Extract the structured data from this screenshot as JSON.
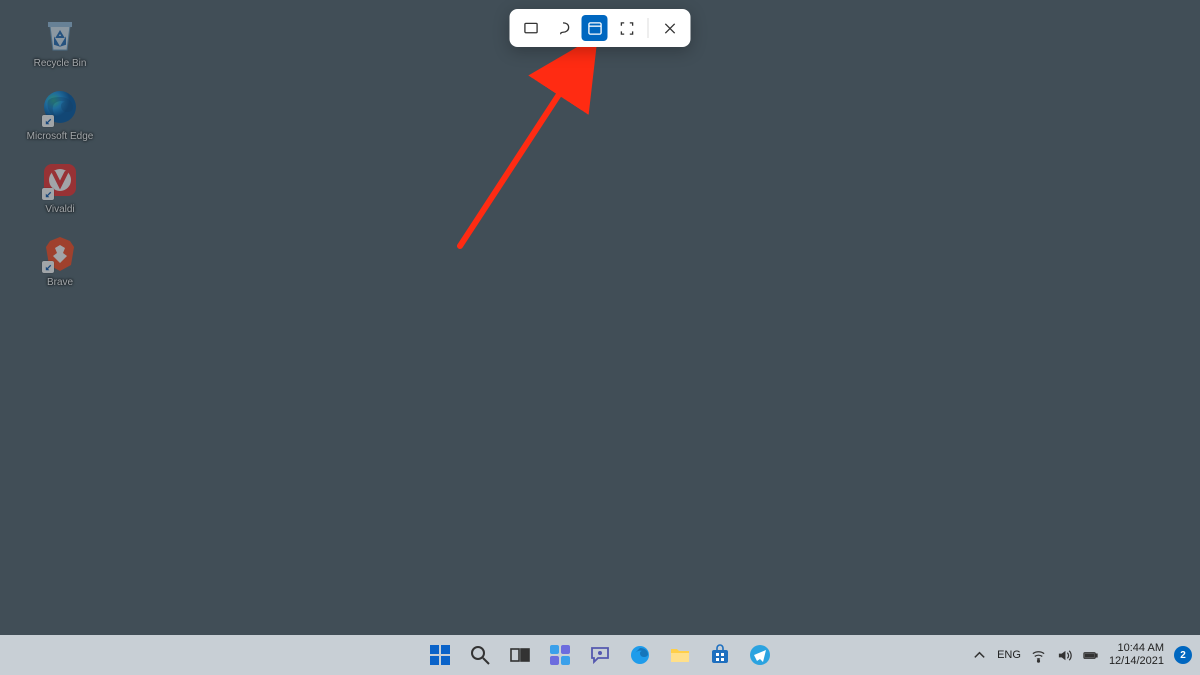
{
  "desktop_icons": [
    {
      "id": "recycle-bin",
      "label": "Recycle Bin",
      "shortcut": false
    },
    {
      "id": "microsoft-edge",
      "label": "Microsoft Edge",
      "shortcut": true
    },
    {
      "id": "vivaldi",
      "label": "Vivaldi",
      "shortcut": true
    },
    {
      "id": "brave",
      "label": "Brave",
      "shortcut": true
    }
  ],
  "snipping_toolbar": {
    "buttons": [
      {
        "id": "rect",
        "name": "rectangular-snip",
        "selected": false
      },
      {
        "id": "freeform",
        "name": "freeform-snip",
        "selected": false
      },
      {
        "id": "window",
        "name": "window-snip",
        "selected": true
      },
      {
        "id": "fullscreen",
        "name": "fullscreen-snip",
        "selected": false
      }
    ],
    "close_label": "Close"
  },
  "annotation": {
    "arrow_color": "#ff2b12"
  },
  "taskbar": {
    "items": [
      {
        "id": "start",
        "name": "start-button"
      },
      {
        "id": "search",
        "name": "search-button"
      },
      {
        "id": "taskview",
        "name": "task-view-button"
      },
      {
        "id": "widgets",
        "name": "widgets-button"
      },
      {
        "id": "chat",
        "name": "chat-button"
      },
      {
        "id": "edge",
        "name": "edge-app"
      },
      {
        "id": "explorer",
        "name": "file-explorer-app"
      },
      {
        "id": "store",
        "name": "microsoft-store-app"
      },
      {
        "id": "telegram",
        "name": "telegram-app"
      }
    ]
  },
  "system_tray": {
    "overflow": "chevron-up-icon",
    "language": "ENG",
    "icons": [
      "wifi-icon",
      "volume-icon",
      "battery-icon"
    ],
    "time": "10:44 AM",
    "date": "12/14/2021",
    "notification_count": "2"
  }
}
